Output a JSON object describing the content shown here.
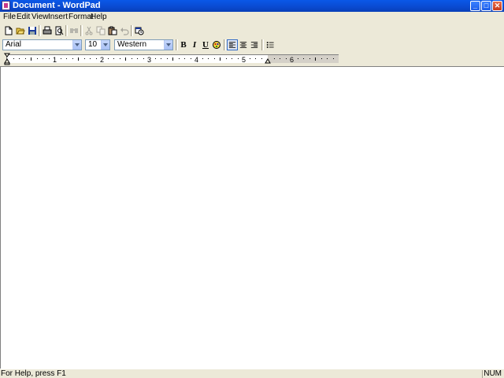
{
  "window": {
    "title": "Document - WordPad",
    "controls": {
      "minimize": "_",
      "maximize": "□",
      "close": "✕"
    }
  },
  "menu": [
    "File",
    "Edit",
    "View",
    "Insert",
    "Format",
    "Help"
  ],
  "toolbar": {
    "buttons": [
      {
        "name": "new-icon",
        "enabled": true
      },
      {
        "name": "open-icon",
        "enabled": true
      },
      {
        "name": "save-icon",
        "enabled": true
      },
      {
        "name": "print-icon",
        "enabled": true
      },
      {
        "name": "print-preview-icon",
        "enabled": true
      },
      {
        "name": "find-icon",
        "enabled": false
      },
      {
        "name": "cut-icon",
        "enabled": false
      },
      {
        "name": "copy-icon",
        "enabled": false
      },
      {
        "name": "paste-icon",
        "enabled": true
      },
      {
        "name": "undo-icon",
        "enabled": false
      },
      {
        "name": "date-time-icon",
        "enabled": true
      }
    ]
  },
  "format": {
    "font": "Arial",
    "size": "10",
    "script": "Western",
    "bold": "B",
    "italic": "I",
    "underline": "U"
  },
  "ruler": {
    "numbers": [
      "1",
      "2",
      "3",
      "4",
      "5",
      "6"
    ]
  },
  "status": {
    "help": "For Help, press F1",
    "num": "NUM"
  }
}
